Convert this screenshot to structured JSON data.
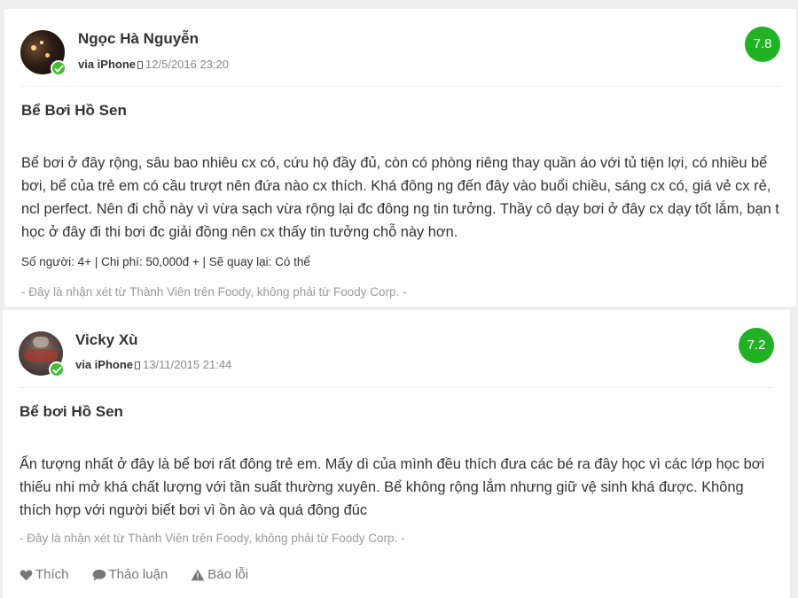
{
  "reviews": [
    {
      "user_name": "Ngọc Hà Nguyễn",
      "via": "via iPhone",
      "date": "12/5/2016 23:20",
      "score": "7.8",
      "title": "Bể Bơi Hồ Sen",
      "body": "Bể bơi ở đây rộng, sâu bao nhiêu cx có, cứu hộ đầy đủ, còn có phòng riêng thay quần áo với tủ tiện lợi, có nhiều bể bơi, bể của trẻ em có cầu trượt nên đứa nào cx thích. Khá đông ng đến đây vào buổi chiều, sáng cx có, giá vẻ cx rẻ, ncl perfect. Nên đi chỗ này vì vừa sạch vừa rộng lại đc đông ng tin tưởng. Thầy cô dạy bơi ở đây cx dạy tốt lắm, bạn t học ở đây đi thi bơi đc giải đồng nên cx thấy tin tưởng chỗ này hơn.",
      "stats": "Số người: 4+ | Chi phí: 50,000đ + | Sẽ quay lại: Có thể",
      "note": "- Đây là nhận xét từ Thành Viên trên Foody, không phải từ Foody Corp. -"
    },
    {
      "user_name": "Vicky Xù",
      "via": "via iPhone",
      "date": "13/11/2015 21:44",
      "score": "7.2",
      "title": "Bể bơi Hồ Sen",
      "body": "Ấn tượng nhất ở đây là bể bơi rất đông trẻ em. Mấy dì của mình đều thích đưa các bé ra đây học vì các lớp học bơi thiếu nhi mở khá chất lượng với tần suất thường xuyên. Bể không rộng lắm nhưng giữ vệ sinh khá được. Không thích hợp với người biết bơi vì ồn ào và quá đông đúc",
      "note": "- Đây là nhận xét từ Thành Viên trên Foody, không phải từ Foody Corp. -",
      "actions": {
        "like": "Thích",
        "discuss": "Thảo luận",
        "report": "Báo lỗi"
      }
    }
  ],
  "colors": {
    "score_bg": "#20b222",
    "verified": "#3fbf2e"
  },
  "icons": [
    "verified-check-icon",
    "phone-icon",
    "heart-icon",
    "comment-icon",
    "warning-icon"
  ]
}
